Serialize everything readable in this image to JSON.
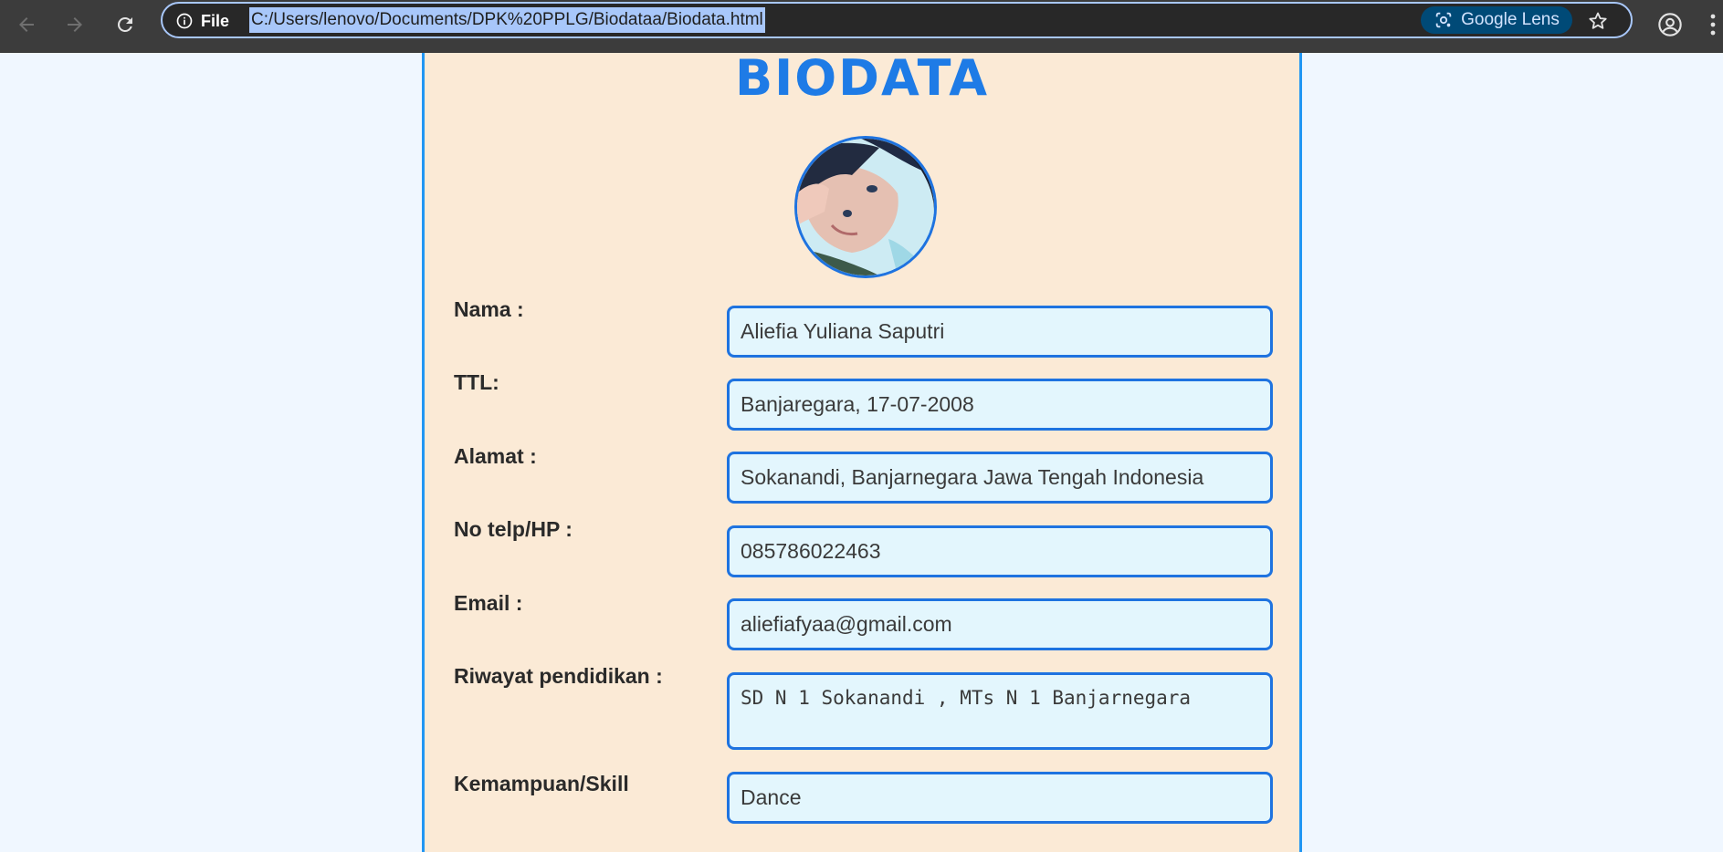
{
  "browser": {
    "site_info_label": "File",
    "url": "C:/Users/lenovo/Documents/DPK%20PPLG/Biodataa/Biodata.html",
    "lens_label": "Google Lens"
  },
  "page": {
    "title": "BIODATA",
    "fields": [
      {
        "label": "Nama :",
        "value": "Aliefia Yuliana Saputri"
      },
      {
        "label": "TTL:",
        "value": "Banjaregara, 17-07-2008"
      },
      {
        "label": "Alamat :",
        "value": "Sokanandi, Banjarnegara Jawa Tengah Indonesia"
      },
      {
        "label": "No telp/HP :",
        "value": "085786022463"
      },
      {
        "label": "Email :",
        "value": "aliefiafyaa@gmail.com"
      },
      {
        "label": "Riwayat pendidikan :",
        "value": "SD N 1 Sokanandi , MTs N 1 Banjarnegara"
      },
      {
        "label": "Kemampuan/Skill",
        "value": "Dance"
      }
    ]
  },
  "colors": {
    "accent": "#1e7be6",
    "card_background": "#fbead6",
    "page_background": "#f0f7ff",
    "field_background": "#e3f6fd",
    "chrome_background": "#3c3c3c"
  }
}
